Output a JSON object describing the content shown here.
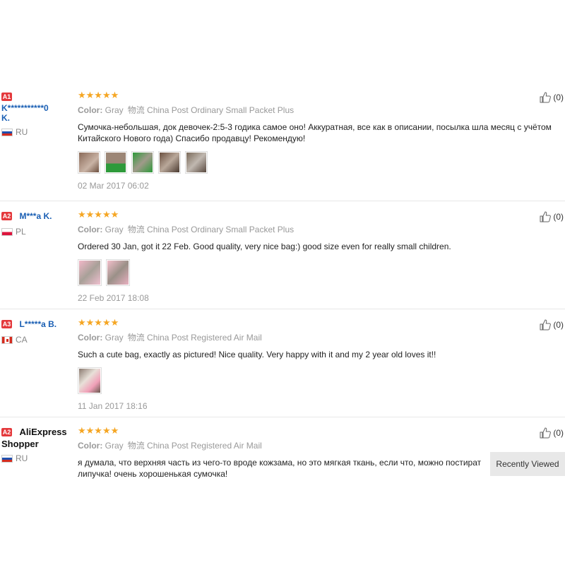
{
  "reviews": [
    {
      "badge": "A1",
      "user": "K***********0",
      "user_line2": "K.",
      "country": "RU",
      "stars": "★★★★★",
      "color_label": "Color:",
      "color_value": "Gray",
      "ship_icon": "物流",
      "shipping": "China Post Ordinary Small Packet Plus",
      "text": "Сумочка-небольшая, док девочек-2:5-3 годика самое оно! Аккуратная, все как в описании, посылка шла месяц с учётом Китайского Нового года) Спасибо продавцу! Рекомендую!",
      "photos": [
        "photo-1",
        "photo-2",
        "photo-3",
        "photo-4",
        "photo-5"
      ],
      "date": "02 Mar 2017 06:02",
      "helpful": "(0)"
    },
    {
      "badge": "A2",
      "user": "M***a K.",
      "country": "PL",
      "stars": "★★★★★",
      "color_label": "Color:",
      "color_value": "Gray",
      "ship_icon": "物流",
      "shipping": "China Post Ordinary Small Packet Plus",
      "text": "Ordered 30 Jan, got it 22 Feb. Good quality, very nice bag:) good size even for really small children.",
      "photos": [
        "photo-1",
        "photo-2"
      ],
      "date": "22 Feb 2017 18:08",
      "helpful": "(0)"
    },
    {
      "badge": "A3",
      "user": "L*****a B.",
      "country": "CA",
      "stars": "★★★★★",
      "color_label": "Color:",
      "color_value": "Gray",
      "ship_icon": "物流",
      "shipping": "China Post Registered Air Mail",
      "text": "Such a cute bag, exactly as pictured! Nice quality. Very happy with it and my 2 year old loves it!!",
      "photos": [
        "photo-1"
      ],
      "date": "11 Jan 2017 18:16",
      "helpful": "(0)"
    },
    {
      "badge": "A2",
      "user": "AliExpress",
      "user_line2": "Shopper",
      "country": "RU",
      "stars": "★★★★★",
      "color_label": "Color:",
      "color_value": "Gray",
      "ship_icon": "物流",
      "shipping": "China Post Registered Air Mail",
      "text": "я думала, что верхняя часть из чего-то вроде кожзама, но это мягкая ткань, если что, можно постират",
      "text_line2": "липучка! очень хорошенькая сумочка!",
      "date": "",
      "helpful": "(0)"
    }
  ],
  "recently_viewed": "Recently Viewed"
}
